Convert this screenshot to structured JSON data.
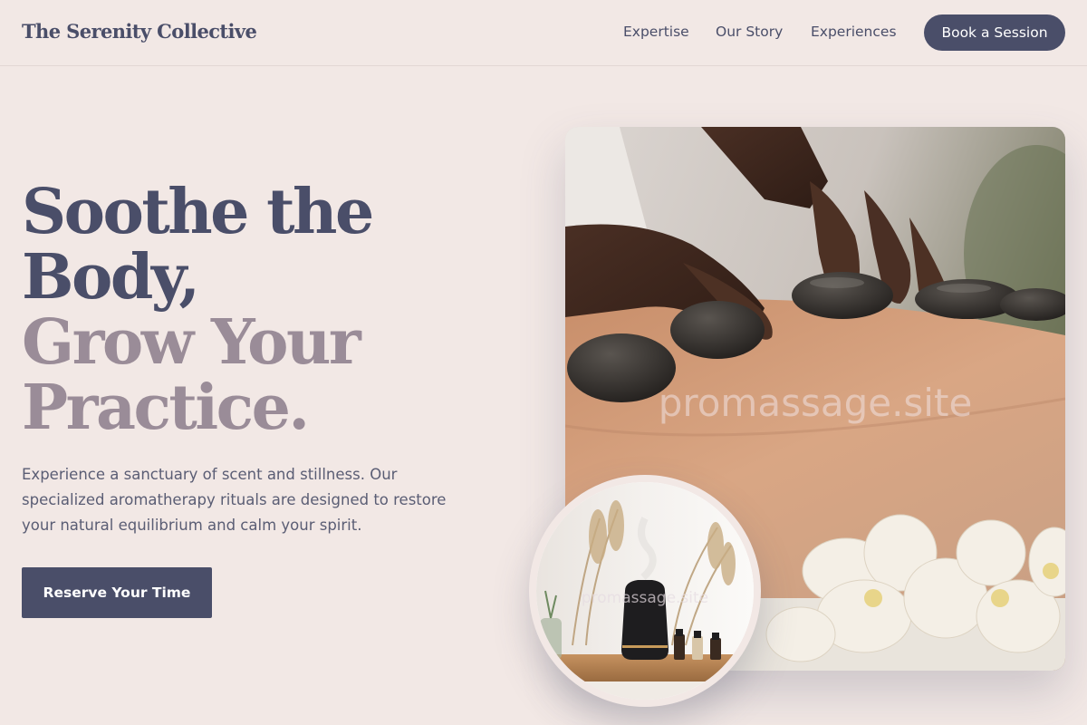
{
  "brand": {
    "name": "The Serenity Collective"
  },
  "nav": {
    "links": [
      "Expertise",
      "Our Story",
      "Experiences"
    ],
    "cta_label": "Book a Session"
  },
  "hero": {
    "headline_line1": "Soothe the",
    "headline_line2": "Body,",
    "headline_line3": "Grow Your",
    "headline_line4": "Practice.",
    "lead": "Experience a sanctuary of scent and stillness. Our specialized aromatherapy rituals are designed to restore your natural equilibrium and calm your spirit.",
    "cta_label": "Reserve Your Time"
  },
  "images": {
    "main_watermark": "promassage.site",
    "inset_watermark": "promassage.site",
    "main_subject": "hot-stone-massage",
    "inset_subject": "aroma-diffuser-with-oils"
  },
  "colors": {
    "background": "#f2e8e5",
    "primary": "#4a4e69",
    "secondary": "#9a8c98"
  }
}
